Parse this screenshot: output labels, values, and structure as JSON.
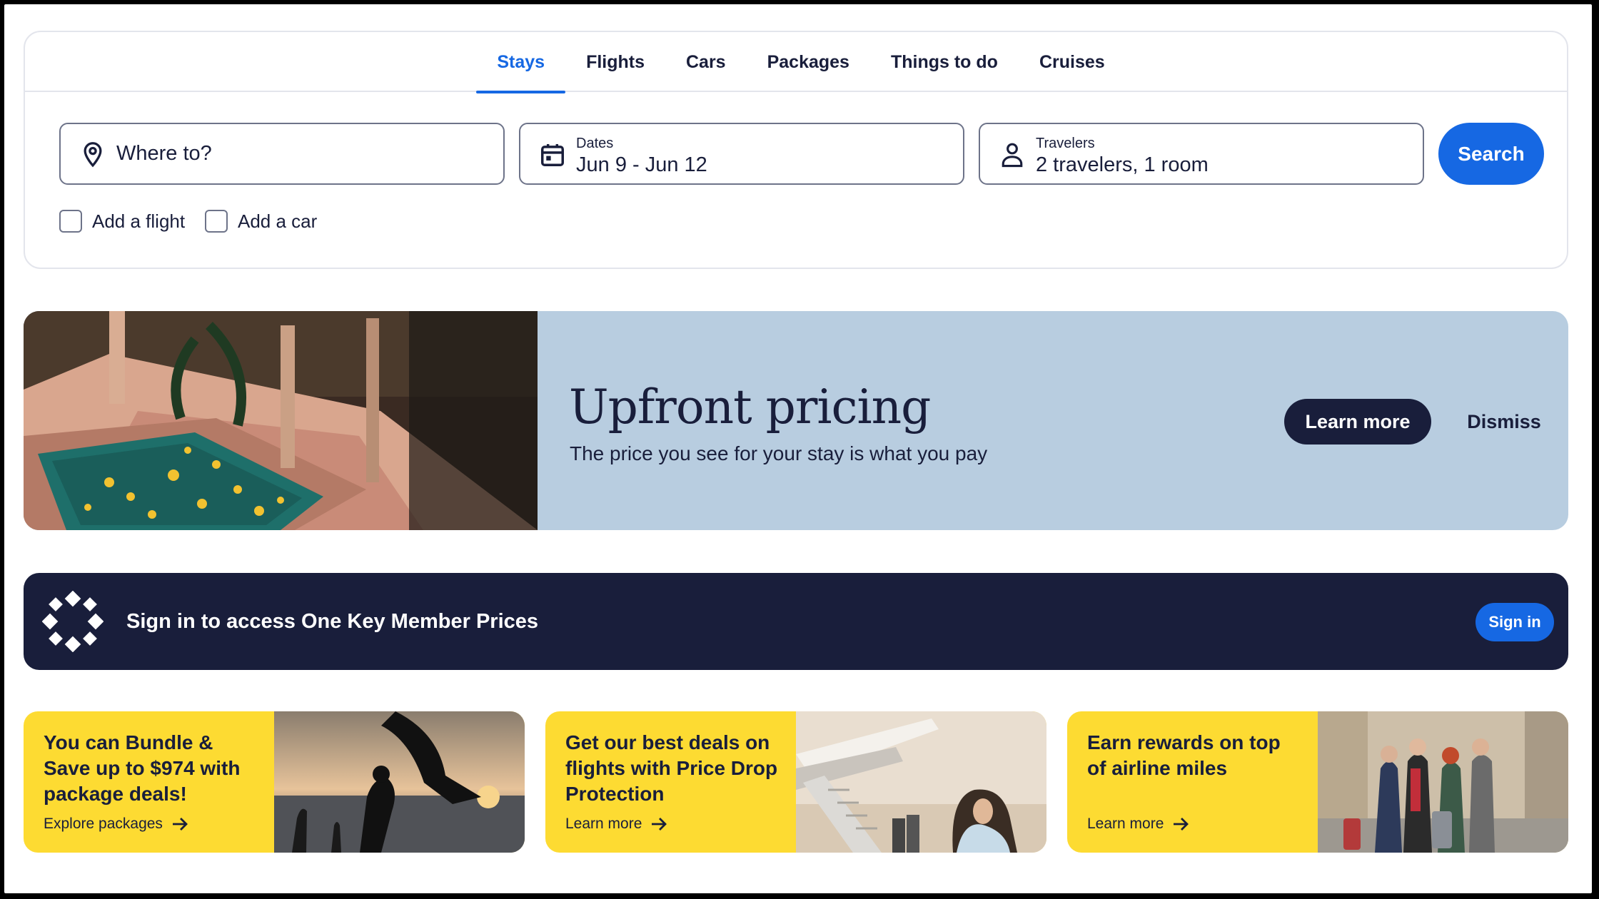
{
  "tabs": [
    {
      "label": "Stays",
      "active": true
    },
    {
      "label": "Flights"
    },
    {
      "label": "Cars"
    },
    {
      "label": "Packages"
    },
    {
      "label": "Things to do"
    },
    {
      "label": "Cruises"
    }
  ],
  "search": {
    "destination": {
      "placeholder": "Where to?",
      "icon": "location-pin-icon"
    },
    "dates": {
      "label": "Dates",
      "value": "Jun 9 - Jun 12",
      "icon": "calendar-icon"
    },
    "travelers": {
      "label": "Travelers",
      "value": "2 travelers, 1 room",
      "icon": "person-icon"
    },
    "button": "Search",
    "add_flight": "Add a flight",
    "add_car": "Add a car"
  },
  "promo": {
    "title": "Upfront pricing",
    "subtitle": "The price you see for your stay is what you pay",
    "learn_more": "Learn more",
    "dismiss": "Dismiss"
  },
  "signin": {
    "text": "Sign in to access One Key Member Prices",
    "button": "Sign in"
  },
  "offers": [
    {
      "text": "You can Bundle & Save up to $974 with package deals!",
      "link": "Explore packages"
    },
    {
      "text": "Get our best deals on flights with Price Drop Protection",
      "link": "Learn more"
    },
    {
      "text": "Earn rewards on top of airline miles",
      "link": "Learn more"
    }
  ],
  "colors": {
    "accent": "#1668e3",
    "navy": "#191e3b",
    "promo_bg": "#b8cde0",
    "offer_bg": "#fddb32"
  }
}
